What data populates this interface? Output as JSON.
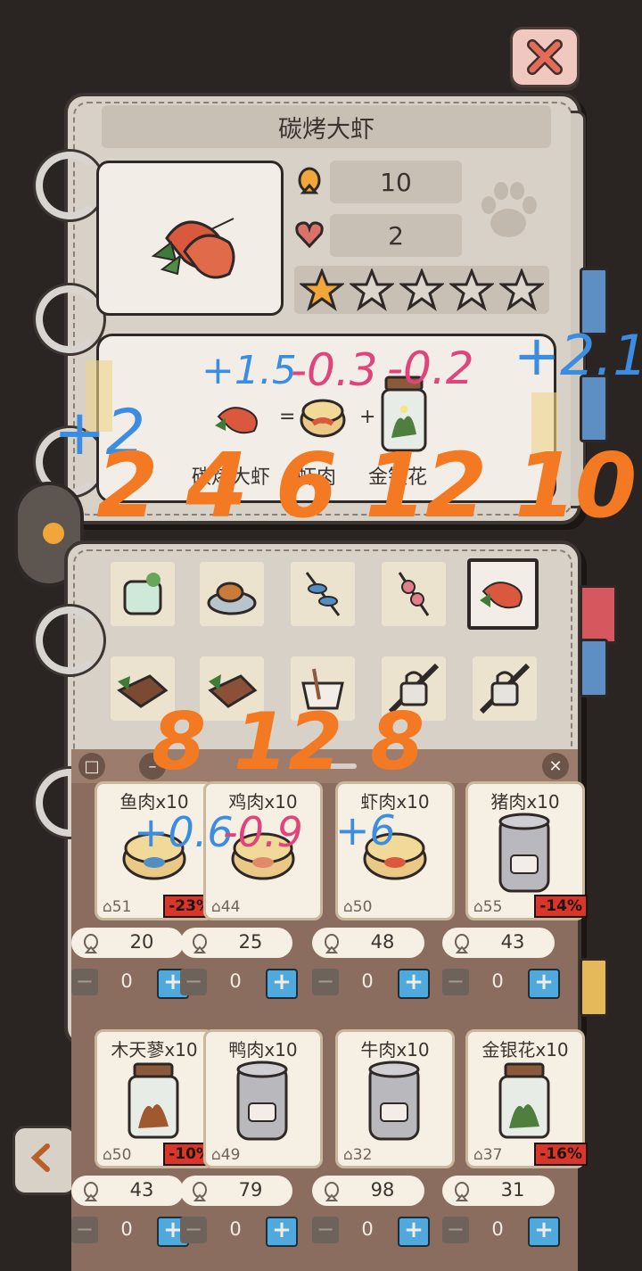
{
  "dish": {
    "title": "碳烤大虾",
    "fish_value": "10",
    "heart_value": "2",
    "stars_filled": 1,
    "stars_total": 5
  },
  "recipe": {
    "equals": "=",
    "plus": "+",
    "labels": [
      "碳烤大虾",
      "虾肉",
      "金银花"
    ]
  },
  "annotations": {
    "top_blue_1": "+1.5",
    "top_pink_1": "-0.3",
    "top_pink_2": "-0.2",
    "top_blue_2": "+2.1",
    "left_blue": "+2",
    "orange_row": "2 4 6 12 10",
    "orange_mid": "8 12 8",
    "blue_mid_1": "+0.6",
    "pink_mid": "-0.9",
    "blue_mid_2": "+6"
  },
  "shop": {
    "items": [
      {
        "name": "鱼肉x10",
        "stock": "51",
        "discount": "-23%",
        "price": "20",
        "qty": "0"
      },
      {
        "name": "鸡肉x10",
        "stock": "44",
        "discount": "",
        "price": "25",
        "qty": "0"
      },
      {
        "name": "虾肉x10",
        "stock": "50",
        "discount": "",
        "price": "48",
        "qty": "0"
      },
      {
        "name": "猪肉x10",
        "stock": "55",
        "discount": "-14%",
        "price": "43",
        "qty": "0"
      },
      {
        "name": "木天蓼x10",
        "stock": "50",
        "discount": "-10%",
        "price": "43",
        "qty": "0"
      },
      {
        "name": "鸭肉x10",
        "stock": "49",
        "discount": "",
        "price": "79",
        "qty": "0"
      },
      {
        "name": "牛肉x10",
        "stock": "32",
        "discount": "",
        "price": "98",
        "qty": "0"
      },
      {
        "name": "金银花x10",
        "stock": "37",
        "discount": "-16%",
        "price": "31",
        "qty": "0"
      }
    ]
  },
  "colors": {
    "background": "#2a2523",
    "paper": "#d8d1c7",
    "plus_button": "#4fa9dc",
    "discount_badge": "#d9352b"
  }
}
